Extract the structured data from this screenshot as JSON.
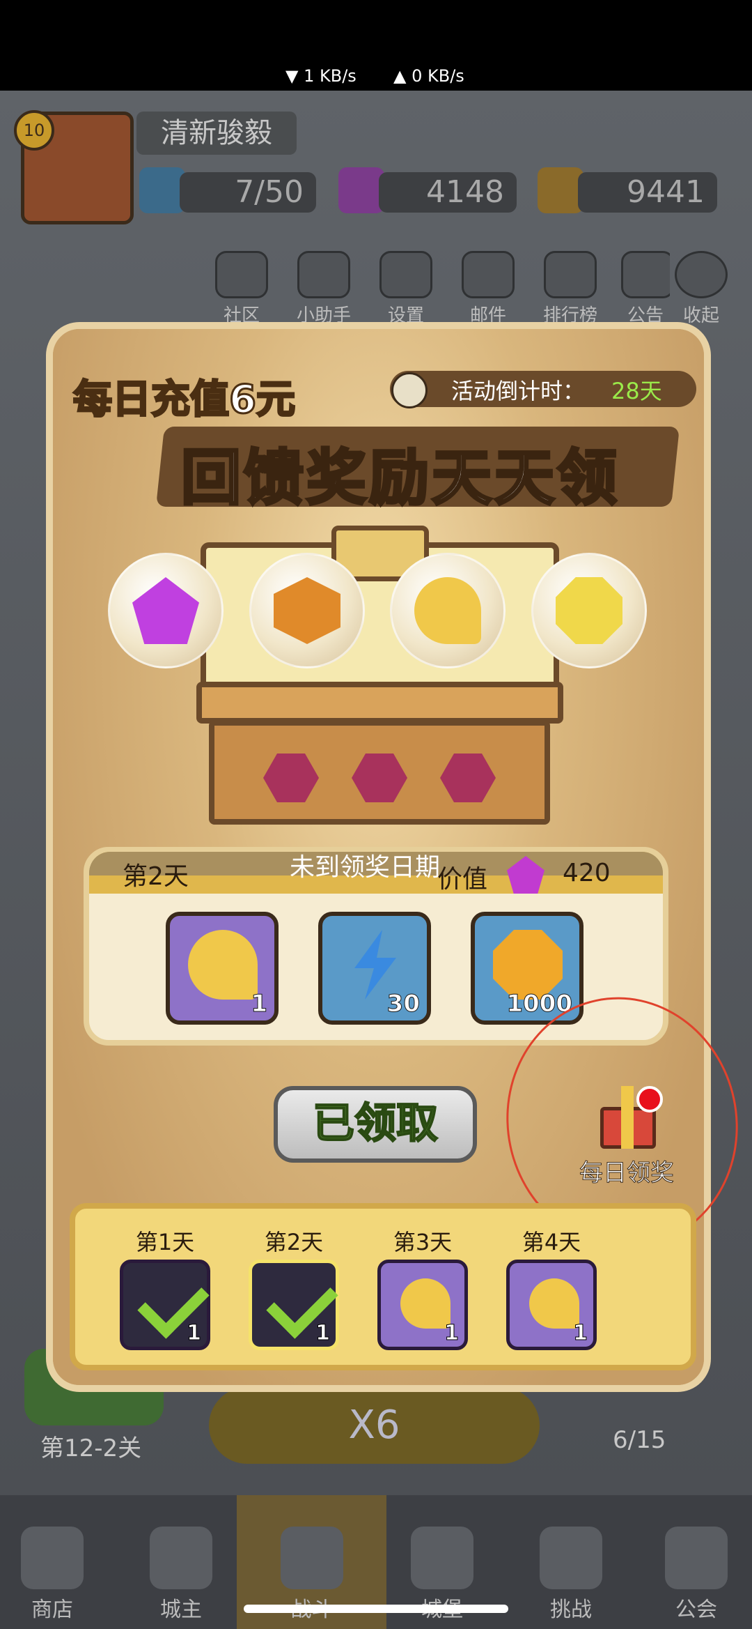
{
  "status_bar": {
    "download": "▼ 1 KB/s",
    "upload": "▲ 0 KB/s"
  },
  "player": {
    "level": "10",
    "name": "清新骏毅"
  },
  "resources": {
    "energy": "7/50",
    "gems": "4148",
    "coins": "9441"
  },
  "top_menu": [
    "社区",
    "小助手",
    "设置",
    "邮件",
    "排行榜",
    "公告",
    "收起"
  ],
  "promo": {
    "title": "每日充值6元",
    "countdown_label": "活动倒计时：",
    "countdown_value": "28天",
    "banner": "回馈奖励天天领"
  },
  "featured_rewards": [
    "purple-gem-icon",
    "orange-gem-icon",
    "golden-key-icon",
    "gold-coin-icon"
  ],
  "day_panel": {
    "day_label": "第2天",
    "status_text": "未到领奖日期",
    "value_label": "价值",
    "value_amount": "420",
    "rewards": [
      {
        "icon": "golden-key-icon",
        "qty": "1"
      },
      {
        "icon": "lightning-energy-icon",
        "qty": "30"
      },
      {
        "icon": "gold-coin-icon",
        "qty": "1000"
      }
    ]
  },
  "claim_button": "已领取",
  "daily_reward_button": "每日领奖",
  "calendar": [
    {
      "label": "第1天",
      "qty": "1",
      "claimed": true
    },
    {
      "label": "第2天",
      "qty": "1",
      "claimed": true
    },
    {
      "label": "第3天",
      "qty": "1",
      "claimed": false
    },
    {
      "label": "第4天",
      "qty": "1",
      "claimed": false
    }
  ],
  "background": {
    "stage_label": "第12-2关",
    "speed_label": "X6",
    "stars_label": "6/15"
  },
  "bottom_nav": [
    "商店",
    "城主",
    "战斗",
    "城堡",
    "挑战",
    "公会"
  ],
  "colors": {
    "accent_green": "#9aea4a",
    "modal_bg": "#c9a16a",
    "gold": "#e0b74c",
    "annotation_red": "#e0422c"
  }
}
